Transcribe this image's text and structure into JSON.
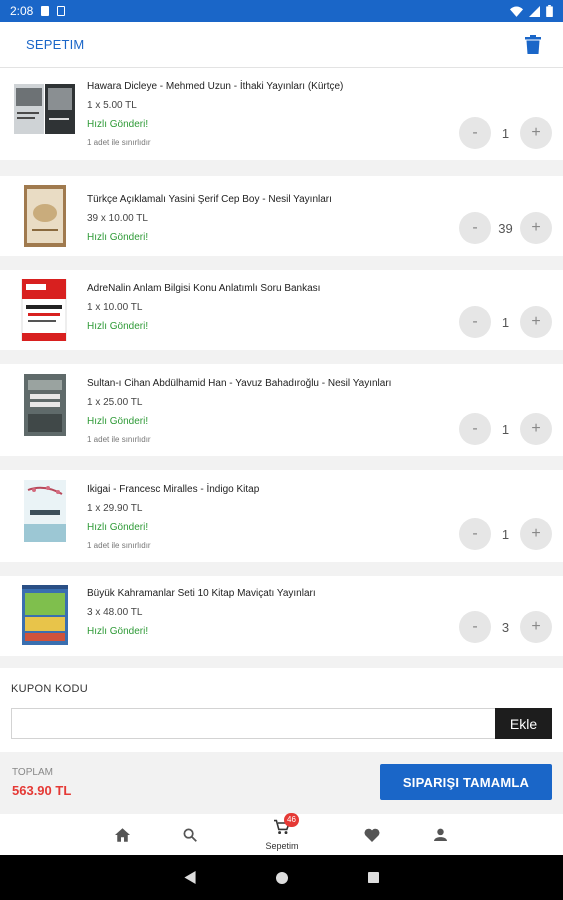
{
  "status_bar": {
    "time": "2:08"
  },
  "header": {
    "title": "SEPETIM"
  },
  "cart_items": [
    {
      "name": "Hawara Dicleye - Mehmed Uzun - İthaki Yayınları (Kürtçe)",
      "price": "1 x 5.00 TL",
      "shipping": "Hızlı Gönderi!",
      "stock": "1 adet ile sınırlıdır",
      "qty": "1",
      "decrement": "-",
      "increment": "+"
    },
    {
      "name": "Türkçe Açıklamalı Yasini Şerif Cep Boy - Nesil Yayınları",
      "price": "39 x 10.00 TL",
      "shipping": "Hızlı Gönderi!",
      "stock": "",
      "qty": "39",
      "decrement": "-",
      "increment": "+"
    },
    {
      "name": "AdreNalin Anlam Bilgisi Konu Anlatımlı Soru Bankası",
      "price": "1 x 10.00 TL",
      "shipping": "Hızlı Gönderi!",
      "stock": "",
      "qty": "1",
      "decrement": "-",
      "increment": "+"
    },
    {
      "name": "Sultan-ı Cihan Abdülhamid Han - Yavuz Bahadıroğlu - Nesil Yayınları",
      "price": "1 x 25.00 TL",
      "shipping": "Hızlı Gönderi!",
      "stock": "1 adet ile sınırlıdır",
      "qty": "1",
      "decrement": "-",
      "increment": "+"
    },
    {
      "name": "Ikigai - Francesc Miralles - İndigo Kitap",
      "price": "1 x 29.90 TL",
      "shipping": "Hızlı Gönderi!",
      "stock": "1 adet ile sınırlıdır",
      "qty": "1",
      "decrement": "-",
      "increment": "+"
    },
    {
      "name": "Büyük Kahramanlar Seti 10 Kitap Maviçatı Yayınları",
      "price": "3 x 48.00 TL",
      "shipping": "Hızlı Gönderi!",
      "stock": "",
      "qty": "3",
      "decrement": "-",
      "increment": "+"
    }
  ],
  "coupon": {
    "label": "KUPON KODU",
    "value": "",
    "button": "Ekle"
  },
  "total": {
    "label": "TOPLAM",
    "value": "563.90 TL",
    "button": "SIPARIŞI TAMAMLA"
  },
  "bottom_nav": {
    "cart_label": "Sepetim",
    "cart_badge": "46"
  },
  "colors": {
    "primary": "#1a66c8",
    "accent_red": "#e53935",
    "success_green": "#2e9a36"
  }
}
